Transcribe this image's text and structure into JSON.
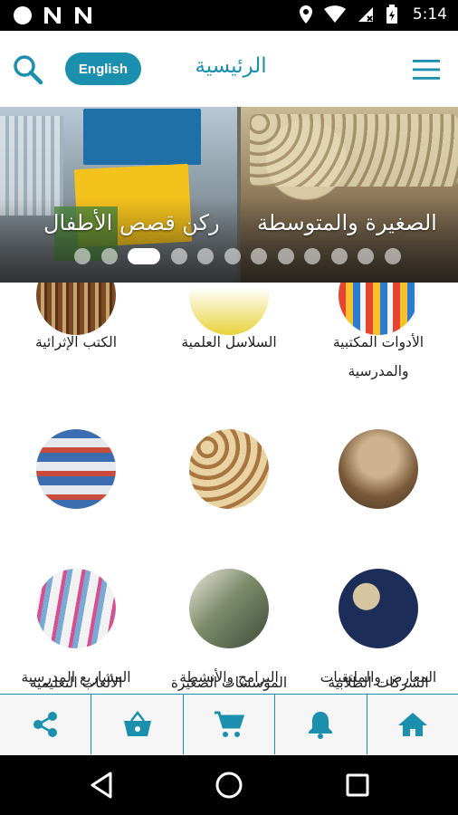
{
  "status_bar": {
    "time": "5:14",
    "icons": [
      "circle-notification-icon",
      "n-notification-icon",
      "n-notification-icon",
      "location-icon",
      "wifi-icon",
      "no-sim-icon",
      "battery-charging-icon"
    ]
  },
  "app_bar": {
    "title": "الرئيسية",
    "language_button": "English",
    "icons": {
      "search": "search-icon",
      "menu": "hamburger-menu-icon"
    }
  },
  "carousel": {
    "captions": [
      "ركن قصص الأطفال",
      "الصغيرة والمتوسطة"
    ],
    "dot_count": 12,
    "active_dot": 2
  },
  "categories": [
    {
      "label": "الكتب الإثرائية",
      "image": "bookshelf"
    },
    {
      "label": "السلاسل العلمية",
      "image": "science-books"
    },
    {
      "label": "الأدوات المكتبية والمدرسية",
      "image": "stationery-pencils"
    },
    {
      "label": "الألعاب التعليمية",
      "image": "toy-shelves"
    },
    {
      "label": "المؤسسات الصغيرة",
      "image": "sweets-platters"
    },
    {
      "label": "الشركات الطلابية",
      "image": "coffee-stand"
    },
    {
      "label": "المشاريع المدرسية",
      "image": "store-aisle"
    },
    {
      "label": "البرامج والأنشطة",
      "image": "activity-people"
    },
    {
      "label": "المعارض والملتقيات",
      "image": "exhibition-poster"
    }
  ],
  "bottom_nav": {
    "items": [
      "share-icon",
      "basket-icon",
      "cart-icon",
      "bell-icon",
      "home-icon"
    ]
  },
  "colors": {
    "accent": "#1a8fae",
    "bottom_nav_bg": "#f6f6f6",
    "status_bar": "#000000"
  }
}
